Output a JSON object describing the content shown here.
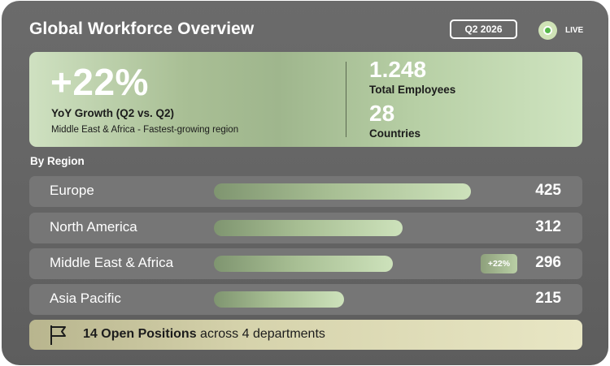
{
  "header": {
    "title": "Global Workforce Overview",
    "period": "Q2 2026",
    "status": "LIVE"
  },
  "hero": {
    "growth_value": "+22%",
    "growth_label": "YoY Growth (Q2 vs. Q2)",
    "growth_sub": "Middle East & Africa - Fastest-growing region",
    "stats": [
      {
        "value": "1.248",
        "label": "Total Employees"
      },
      {
        "value": "28",
        "label": "Countries"
      }
    ]
  },
  "regions": {
    "section_label": "By Region",
    "max": 425,
    "items": [
      {
        "name": "Europe",
        "value": 425,
        "value_text": "425",
        "badge": ""
      },
      {
        "name": "North America",
        "value": 312,
        "value_text": "312",
        "badge": ""
      },
      {
        "name": "Middle East & Africa",
        "value": 296,
        "value_text": "296",
        "badge": "+22%"
      },
      {
        "name": "Asia Pacific",
        "value": 215,
        "value_text": "215",
        "badge": ""
      }
    ]
  },
  "footer": {
    "icon": "flag-icon",
    "bold_text": "14 Open Positions",
    "rest_text": " across 4 departments"
  },
  "colors": {
    "accent_green": "#56b84a",
    "bar_end": "#cde2bb",
    "footer_bg": "#d6d3ac"
  }
}
